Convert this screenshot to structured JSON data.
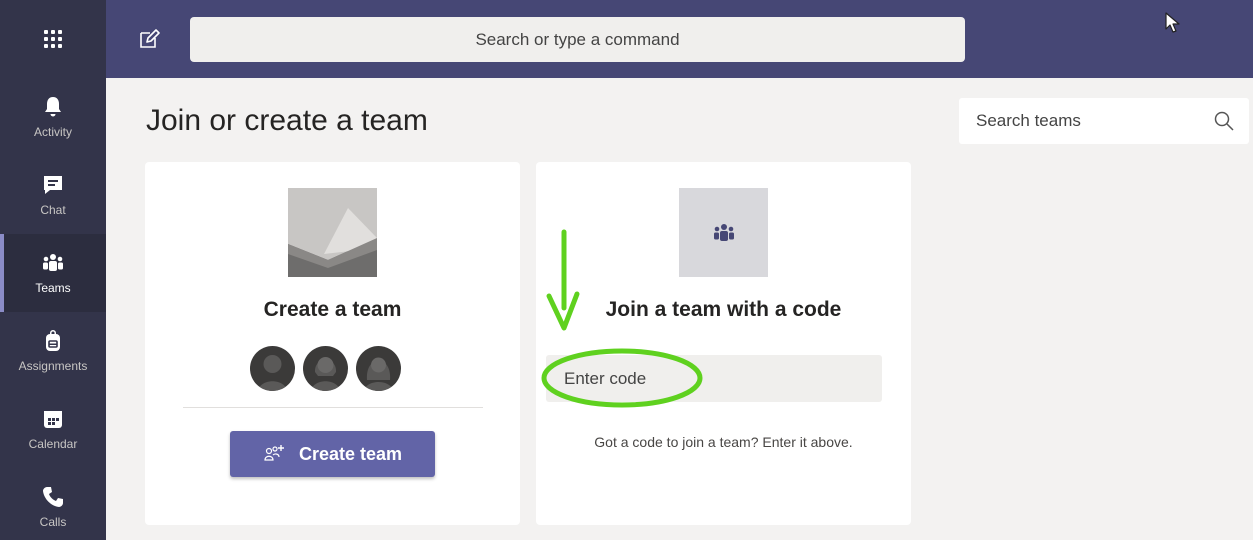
{
  "topbar": {
    "search_placeholder": "Search or type a command"
  },
  "rail": {
    "items": [
      {
        "label": "Activity",
        "icon": "bell-icon"
      },
      {
        "label": "Chat",
        "icon": "chat-icon"
      },
      {
        "label": "Teams",
        "icon": "teams-icon",
        "active": true
      },
      {
        "label": "Assignments",
        "icon": "backpack-icon"
      },
      {
        "label": "Calendar",
        "icon": "calendar-icon"
      },
      {
        "label": "Calls",
        "icon": "phone-icon"
      }
    ]
  },
  "main": {
    "title": "Join or create a team",
    "search_teams_placeholder": "Search teams",
    "create_card": {
      "heading": "Create a team",
      "button_label": "Create team"
    },
    "join_card": {
      "heading": "Join a team with a code",
      "input_placeholder": "Enter code",
      "help_text": "Got a code to join a team? Enter it above."
    }
  },
  "colors": {
    "topbar": "#464775",
    "rail": "#33344a",
    "accent": "#6264a7",
    "annotation": "#5fd11f"
  }
}
